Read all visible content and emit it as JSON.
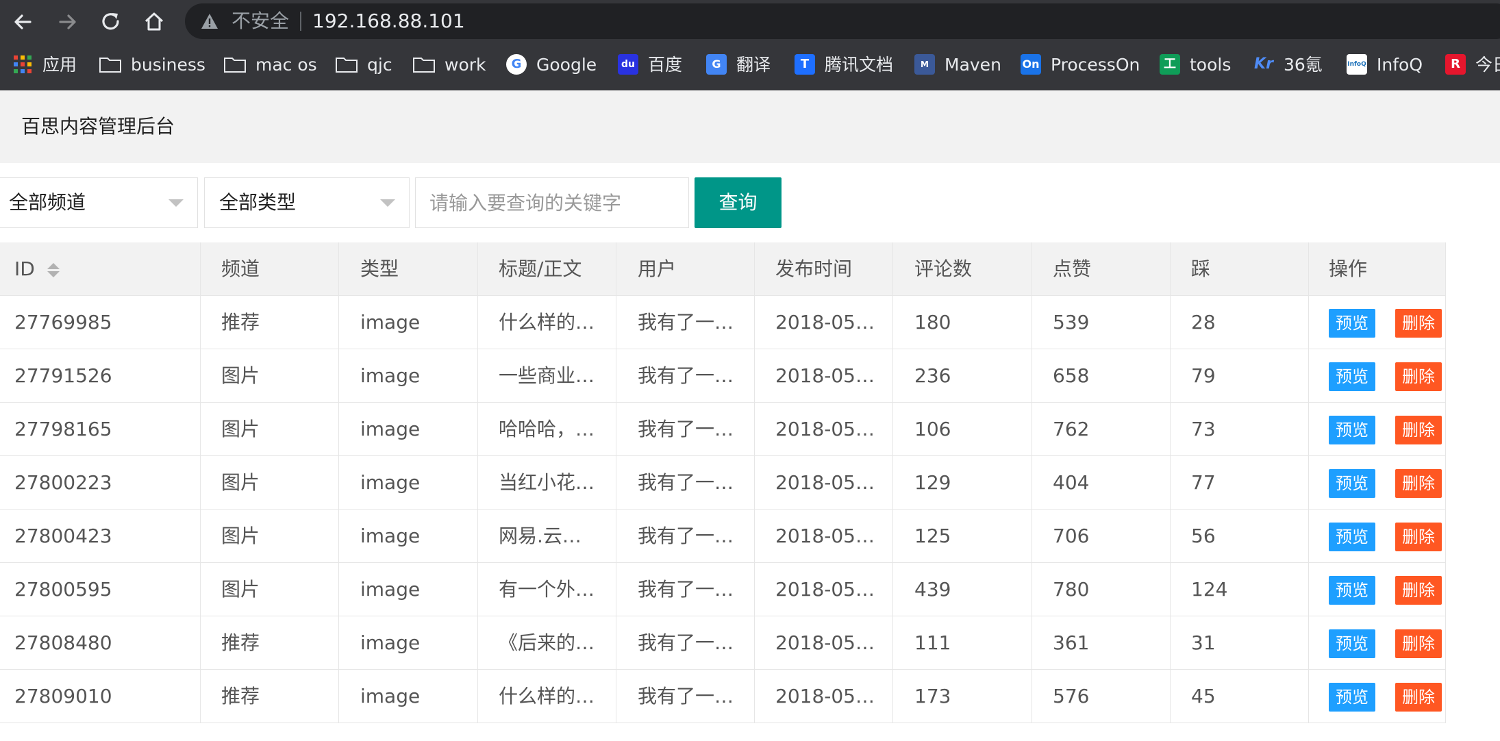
{
  "browser": {
    "insecure_label": "不安全",
    "url": "192.168.88.101",
    "bookmarks": [
      {
        "label": "应用",
        "icon": "apps-grid-icon"
      },
      {
        "label": "business",
        "icon": "folder-icon"
      },
      {
        "label": "mac os",
        "icon": "folder-icon"
      },
      {
        "label": "qjc",
        "icon": "folder-icon"
      },
      {
        "label": "work",
        "icon": "folder-icon"
      },
      {
        "label": "Google",
        "icon": "google-icon"
      },
      {
        "label": "百度",
        "icon": "baidu-icon"
      },
      {
        "label": "翻译",
        "icon": "translate-icon"
      },
      {
        "label": "腾讯文档",
        "icon": "tencent-docs-icon"
      },
      {
        "label": "Maven",
        "icon": "maven-icon"
      },
      {
        "label": "ProcessOn",
        "icon": "processon-icon"
      },
      {
        "label": "tools",
        "icon": "tools-icon"
      },
      {
        "label": "36氪",
        "icon": "36kr-icon"
      },
      {
        "label": "InfoQ",
        "icon": "infoq-icon"
      },
      {
        "label": "今日",
        "icon": "r-icon"
      }
    ]
  },
  "page": {
    "title": "百思内容管理后台"
  },
  "filters": {
    "channel_select": "全部频道",
    "type_select": "全部类型",
    "search_placeholder": "请输入要查询的关键字",
    "search_button": "查询"
  },
  "table": {
    "headers": [
      "ID",
      "频道",
      "类型",
      "标题/正文",
      "用户",
      "发布时间",
      "评论数",
      "点赞",
      "踩",
      "操作"
    ],
    "preview_label": "预览",
    "delete_label": "删除",
    "rows": [
      [
        "27769985",
        "推荐",
        "image",
        "什么样的…",
        "我有了一…",
        "2018-05…",
        "180",
        "539",
        "28"
      ],
      [
        "27791526",
        "图片",
        "image",
        "一些商业…",
        "我有了一…",
        "2018-05…",
        "236",
        "658",
        "79"
      ],
      [
        "27798165",
        "图片",
        "image",
        "哈哈哈，…",
        "我有了一…",
        "2018-05…",
        "106",
        "762",
        "73"
      ],
      [
        "27800223",
        "图片",
        "image",
        "当红小花…",
        "我有了一…",
        "2018-05…",
        "129",
        "404",
        "77"
      ],
      [
        "27800423",
        "图片",
        "image",
        "网易.云…",
        "我有了一…",
        "2018-05…",
        "125",
        "706",
        "56"
      ],
      [
        "27800595",
        "图片",
        "image",
        "有一个外…",
        "我有了一…",
        "2018-05…",
        "439",
        "780",
        "124"
      ],
      [
        "27808480",
        "推荐",
        "image",
        "《后来的…",
        "我有了一…",
        "2018-05…",
        "111",
        "361",
        "31"
      ],
      [
        "27809010",
        "推荐",
        "image",
        "什么样的…",
        "我有了一…",
        "2018-05…",
        "173",
        "576",
        "45"
      ]
    ]
  },
  "colors": {
    "search_button": "#009688",
    "preview_button": "#1e9fff",
    "delete_button": "#ff5722"
  }
}
